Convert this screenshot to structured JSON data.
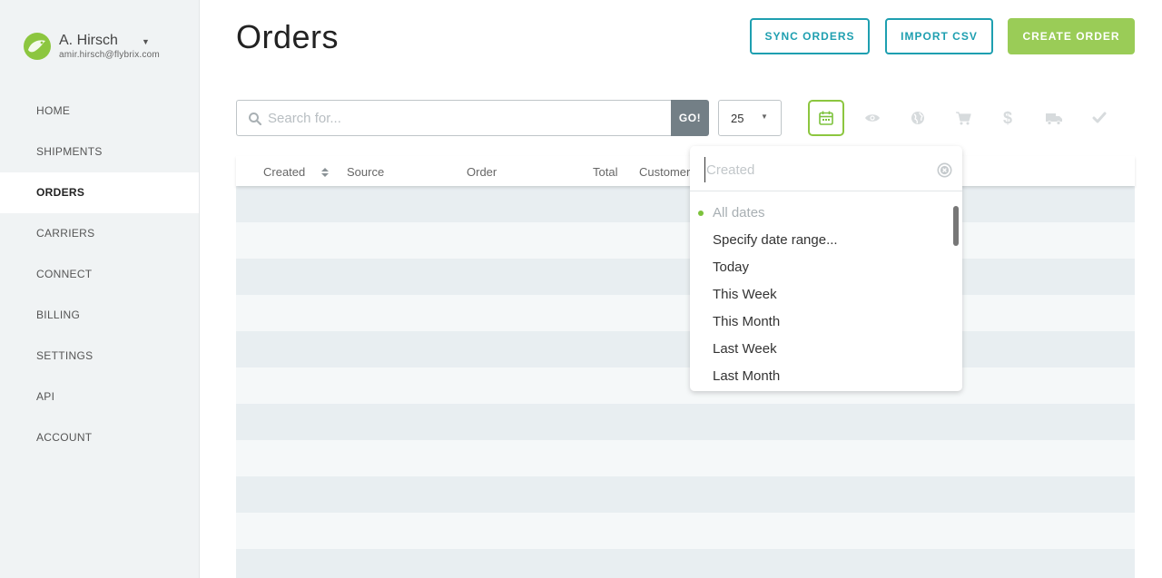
{
  "user": {
    "name": "A. Hirsch",
    "email": "amir.hirsch@flybrix.com",
    "avatar_color": "#8cc63f"
  },
  "sidebar": {
    "items": [
      {
        "label": "HOME",
        "active": false
      },
      {
        "label": "SHIPMENTS",
        "active": false
      },
      {
        "label": "ORDERS",
        "active": true
      },
      {
        "label": "CARRIERS",
        "active": false
      },
      {
        "label": "CONNECT",
        "active": false
      },
      {
        "label": "BILLING",
        "active": false
      },
      {
        "label": "SETTINGS",
        "active": false
      },
      {
        "label": "API",
        "active": false
      },
      {
        "label": "ACCOUNT",
        "active": false
      }
    ]
  },
  "header": {
    "title": "Orders",
    "sync_label": "SYNC ORDERS",
    "import_label": "IMPORT CSV",
    "create_label": "CREATE ORDER"
  },
  "toolbar": {
    "search_placeholder": "Search for...",
    "search_value": "",
    "go_label": "GO!",
    "per_page": "25",
    "filters": [
      {
        "icon": "calendar-icon",
        "active": true
      },
      {
        "icon": "eye-icon",
        "active": false
      },
      {
        "icon": "globe-icon",
        "active": false
      },
      {
        "icon": "cart-icon",
        "active": false
      },
      {
        "icon": "dollar-icon",
        "active": false
      },
      {
        "icon": "truck-icon",
        "active": false
      },
      {
        "icon": "check-icon",
        "active": false
      }
    ]
  },
  "table": {
    "columns": [
      "Created",
      "Source",
      "Order",
      "Total",
      "Customer"
    ],
    "rows": []
  },
  "date_filter": {
    "placeholder": "Created",
    "value": "",
    "options": [
      {
        "label": "All dates",
        "selected": true
      },
      {
        "label": "Specify date range...",
        "selected": false
      },
      {
        "label": "Today",
        "selected": false
      },
      {
        "label": "This Week",
        "selected": false
      },
      {
        "label": "This Month",
        "selected": false
      },
      {
        "label": "Last Week",
        "selected": false
      },
      {
        "label": "Last Month",
        "selected": false
      }
    ]
  },
  "colors": {
    "accent_teal": "#1e9fb0",
    "accent_green": "#9acc57",
    "selected_dot": "#7cc23b"
  }
}
